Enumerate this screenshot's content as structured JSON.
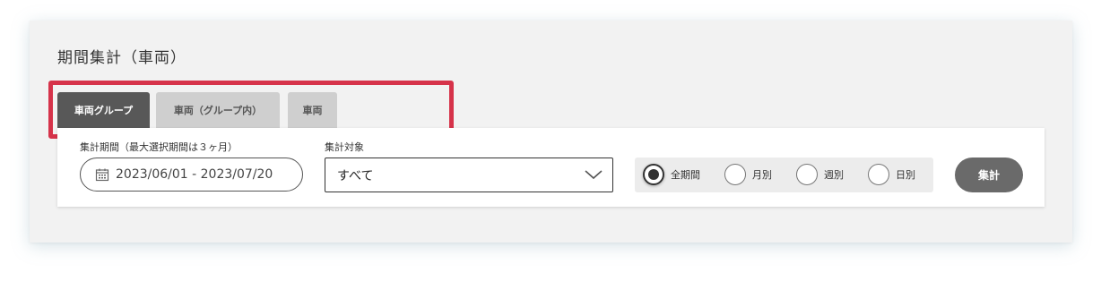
{
  "page": {
    "title": "期間集計（車両）"
  },
  "tabs": [
    {
      "label": "車両グループ",
      "active": true
    },
    {
      "label": "車両（グループ内）",
      "active": false
    },
    {
      "label": "車両",
      "active": false
    }
  ],
  "filters": {
    "period": {
      "label": "集計期間（最大選択期間は３ヶ月）",
      "value": "2023/06/01 - 2023/07/20",
      "icon": "calendar-icon"
    },
    "target": {
      "label": "集計対象",
      "selected": "すべて",
      "icon": "chevron-down-icon"
    },
    "granularity": {
      "options": [
        {
          "label": "全期間",
          "checked": true
        },
        {
          "label": "月別",
          "checked": false
        },
        {
          "label": "週別",
          "checked": false
        },
        {
          "label": "日別",
          "checked": false
        }
      ]
    },
    "submit_label": "集計"
  },
  "colors": {
    "active_tab": "#585858",
    "inactive_tab": "#cfcfcf",
    "highlight": "#d6334a",
    "submit": "#6a6a6a",
    "panel": "#f2f2f2"
  }
}
